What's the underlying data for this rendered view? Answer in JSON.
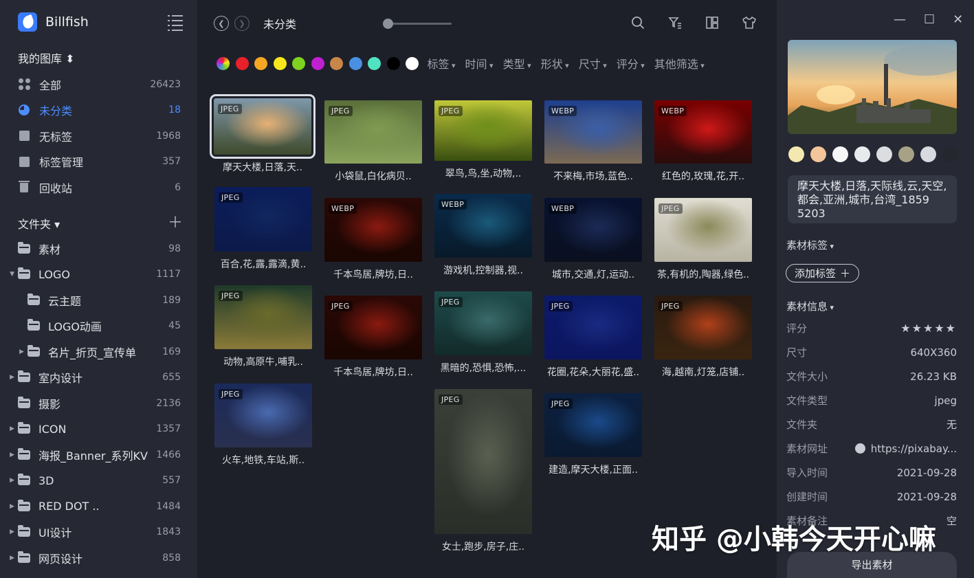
{
  "app": {
    "name": "Billfish"
  },
  "sidebar": {
    "library_title": "我的图库",
    "nav": [
      {
        "label": "全部",
        "count": "26423",
        "icon": "grid-icon"
      },
      {
        "label": "未分类",
        "count": "18",
        "icon": "pie-icon",
        "active": true
      },
      {
        "label": "无标签",
        "count": "1968",
        "icon": "no-tag-icon"
      },
      {
        "label": "标签管理",
        "count": "357",
        "icon": "tag-manage-icon"
      },
      {
        "label": "回收站",
        "count": "6",
        "icon": "trash-icon"
      }
    ],
    "folder_header": "文件夹",
    "folders": [
      {
        "label": "素材",
        "count": "98",
        "arrow": ""
      },
      {
        "label": "LOGO",
        "count": "1117",
        "arrow": "▼"
      },
      {
        "label": "云主题",
        "count": "189",
        "arrow": "",
        "sub": true
      },
      {
        "label": "LOGO动画",
        "count": "45",
        "arrow": "",
        "sub": true
      },
      {
        "label": "名片_折页_宣传单",
        "count": "169",
        "arrow": "▶",
        "sub": true
      },
      {
        "label": "室内设计",
        "count": "655",
        "arrow": "▶"
      },
      {
        "label": "摄影",
        "count": "2136",
        "arrow": ""
      },
      {
        "label": "ICON",
        "count": "1357",
        "arrow": "▶"
      },
      {
        "label": "海报_Banner_系列KV",
        "count": "1466",
        "arrow": "▶"
      },
      {
        "label": "3D",
        "count": "557",
        "arrow": "▶"
      },
      {
        "label": "RED DOT ..",
        "count": "1484",
        "arrow": "▶"
      },
      {
        "label": "UI设计",
        "count": "1843",
        "arrow": "▶"
      },
      {
        "label": "网页设计",
        "count": "858",
        "arrow": "▶"
      }
    ]
  },
  "main": {
    "breadcrumb": "未分类",
    "swatches": [
      "rainbow",
      "#e8202a",
      "#f5a623",
      "#f8e71c",
      "#7ed321",
      "#c020d0",
      "#c8874a",
      "#4a90e2",
      "#50e3c2",
      "#000000",
      "#ffffff"
    ],
    "filters": [
      "标签",
      "时间",
      "类型",
      "形状",
      "尺寸",
      "评分",
      "其他筛选"
    ],
    "items": [
      {
        "badge": "JPEG",
        "caption": "摩天大楼,日落,天..",
        "selected": true
      },
      {
        "badge": "JPEG",
        "caption": "小袋鼠,白化病贝.."
      },
      {
        "badge": "JPEG",
        "caption": "翠鸟,鸟,坐,动物,.."
      },
      {
        "badge": "WEBP",
        "caption": "不来梅,市场,蓝色.."
      },
      {
        "badge": "WEBP",
        "caption": "红色的,玫瑰,花,开.."
      },
      {
        "badge": "JPEG",
        "caption": "百合,花,露,露滴,黄.."
      },
      {
        "badge": "WEBP",
        "caption": "千本鸟居,牌坊,日.."
      },
      {
        "badge": "WEBP",
        "caption": "游戏机,控制器,视.."
      },
      {
        "badge": "WEBP",
        "caption": "城市,交通,灯,运动.."
      },
      {
        "badge": "JPEG",
        "caption": "茶,有机的,陶器,绿色.."
      },
      {
        "badge": "JPEG",
        "caption": "动物,高原牛,哺乳.."
      },
      {
        "badge": "JPEG",
        "caption": "千本鸟居,牌坊,日.."
      },
      {
        "badge": "JPEG",
        "caption": "黑暗的,恐惧,恐怖,..."
      },
      {
        "badge": "JPEG",
        "caption": "花圈,花朵,大丽花,盛.."
      },
      {
        "badge": "JPEG",
        "caption": "海,越南,灯笼,店铺.."
      },
      {
        "badge": "JPEG",
        "caption": "火车,地铁,车站,斯.."
      },
      {
        "badge": "JPEG",
        "caption": "女士,跑步,房子,庄.."
      },
      {
        "badge": "JPEG",
        "caption": "建造,摩天大楼,正面.."
      }
    ]
  },
  "panel": {
    "palette": [
      "#f3e9b0",
      "#f4c49a",
      "#f7f7f7",
      "#e9eaee",
      "#dcdde1",
      "#a7a286",
      "#d9dadf",
      "#25272f"
    ],
    "name": "摩天大楼,日落,天际线,云,天空,都会,亚洲,城市,台湾_1859 5203",
    "tags_title": "素材标签",
    "add_tag": "添加标签",
    "info_title": "素材信息",
    "info": [
      {
        "k": "评分",
        "v": "★★★★★",
        "type": "stars"
      },
      {
        "k": "尺寸",
        "v": "640X360"
      },
      {
        "k": "文件大小",
        "v": "26.23 KB"
      },
      {
        "k": "文件类型",
        "v": "jpeg"
      },
      {
        "k": "文件夹",
        "v": "无"
      },
      {
        "k": "素材网址",
        "v": "https://pixabay...",
        "type": "url"
      },
      {
        "k": "导入时间",
        "v": "2021-09-28"
      },
      {
        "k": "创建时间",
        "v": "2021-09-28"
      },
      {
        "k": "素材备注",
        "v": "空"
      }
    ],
    "export": "导出素材"
  },
  "watermark": "知乎 @小韩今天开心嘛"
}
